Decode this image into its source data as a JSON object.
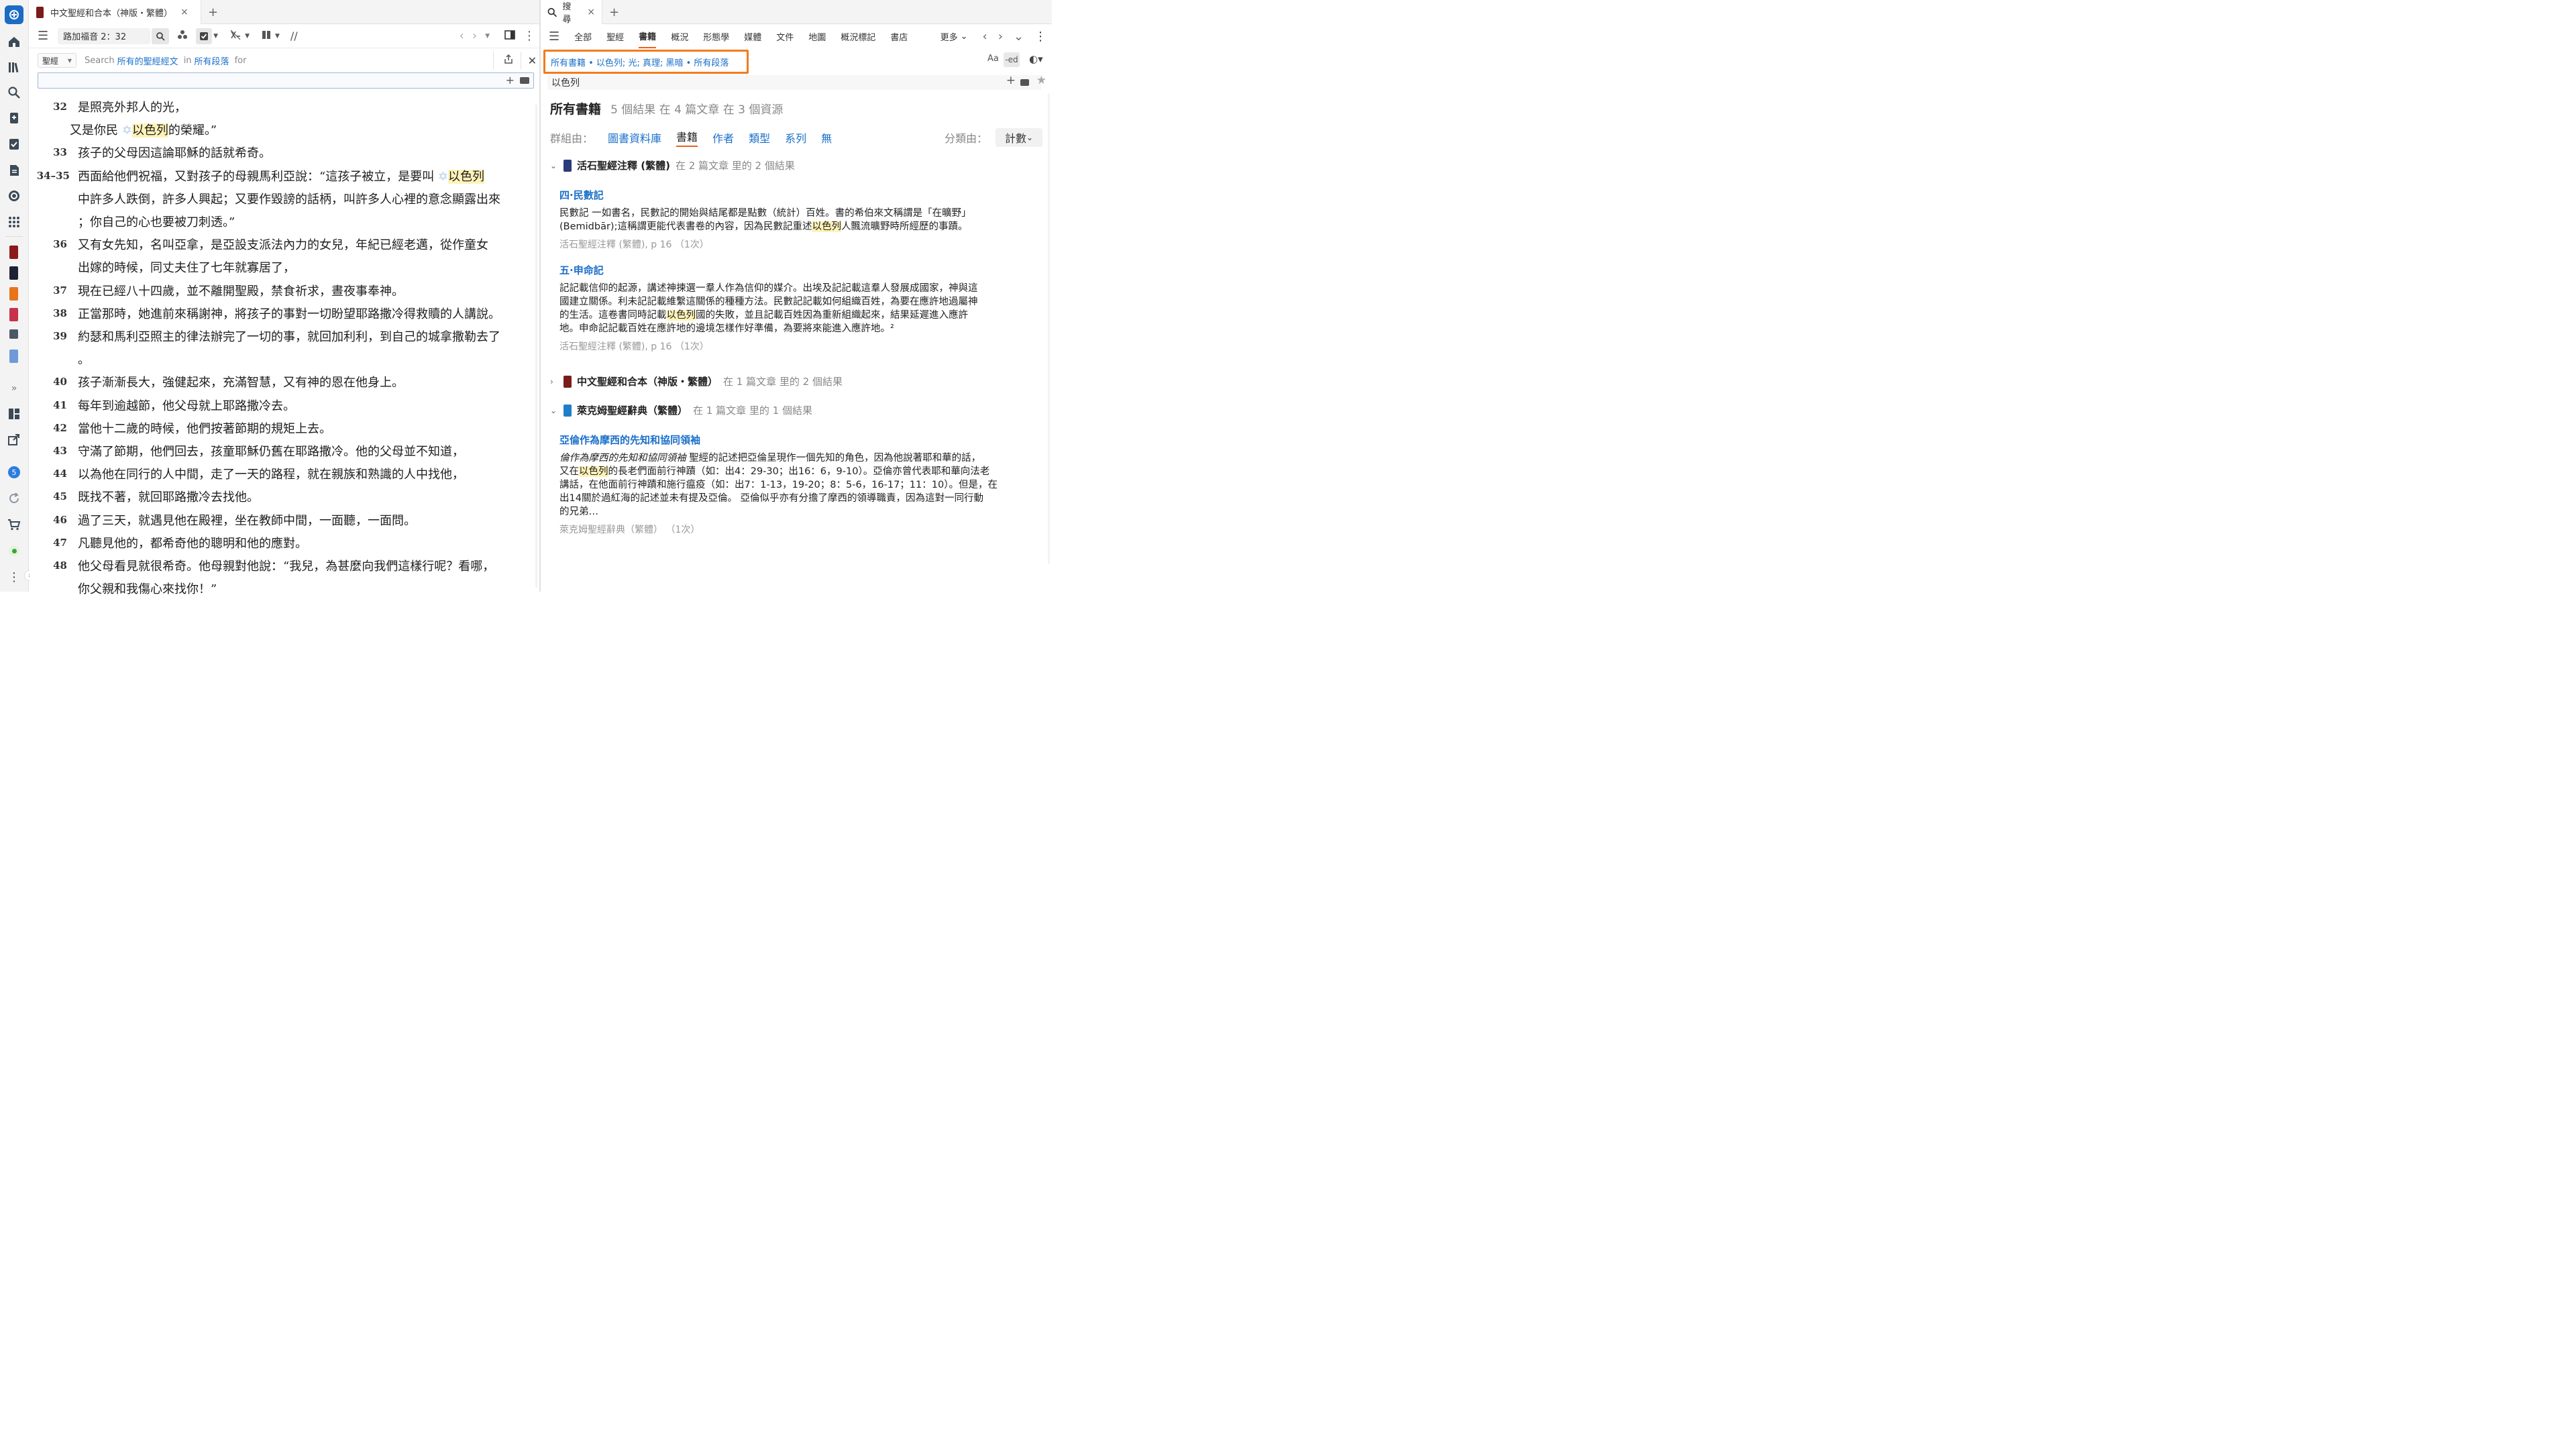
{
  "rail": {
    "icons": [
      "logos-icon",
      "home-icon",
      "library-icon",
      "search-icon",
      "notes-icon",
      "checklist-icon",
      "document-icon",
      "shield-icon",
      "apps-icon"
    ],
    "expand": "»",
    "badge": "5"
  },
  "left": {
    "tab_title": "中文聖經和合本（神版・繁體）",
    "tab_close": "×",
    "new_tab": "+",
    "reference": "路加福音 2：32",
    "search_scope": "聖經",
    "search_line": {
      "prefix": "Search",
      "scope": "所有的聖經經文",
      "in": "in",
      "where": "所有段落",
      "for": "for"
    },
    "verses": [
      {
        "num": "32",
        "parts": [
          {
            "t": "是照亮外邦人的光，"
          }
        ]
      },
      {
        "num": "",
        "indent": true,
        "parts": [
          {
            "t": "又是你民 "
          },
          {
            "t": "✡",
            "star": true
          },
          {
            "t": "以色列",
            "hl": true
          },
          {
            "t": "的榮耀。”"
          }
        ]
      },
      {
        "num": "33",
        "parts": [
          {
            "t": "孩子的父母因這論耶穌的話就希奇。"
          }
        ]
      },
      {
        "num": "34–35",
        "parts": [
          {
            "t": "西面給他們祝福，又對孩子的母親馬利亞說：“這孩子被立，是要叫 "
          },
          {
            "t": "✡",
            "star": true
          },
          {
            "t": "以色列",
            "hl": true
          }
        ]
      },
      {
        "num": "",
        "parts": [
          {
            "t": "中許多人跌倒，許多人興起；又要作毀謗的話柄，叫許多人心裡的意念顯露出來"
          }
        ]
      },
      {
        "num": "",
        "parts": [
          {
            "t": "；你自己的心也要被刀刺透。”"
          }
        ]
      },
      {
        "num": "36",
        "parts": [
          {
            "t": "又有女先知，名叫亞拿，是亞設支派法內力的女兒，年紀已經老邁，從作童女"
          }
        ]
      },
      {
        "num": "",
        "parts": [
          {
            "t": "出嫁的時候，同丈夫住了七年就寡居了，"
          }
        ]
      },
      {
        "num": "37",
        "parts": [
          {
            "t": "現在已經八十四歲，並不離開聖殿，禁食祈求，晝夜事奉神。"
          }
        ]
      },
      {
        "num": "38",
        "parts": [
          {
            "t": "正當那時，她進前來稱謝神，將孩子的事對一切盼望耶路撒冷得救贖的人講說。"
          }
        ]
      },
      {
        "num": "39",
        "parts": [
          {
            "t": "約瑟和馬利亞照主的律法辦完了一切的事，就回加利利，到自己的城拿撒勒去了"
          }
        ]
      },
      {
        "num": "",
        "parts": [
          {
            "t": "。"
          }
        ]
      },
      {
        "num": "40",
        "parts": [
          {
            "t": "孩子漸漸長大，強健起來，充滿智慧，又有神的恩在他身上。"
          }
        ]
      },
      {
        "num": "41",
        "parts": [
          {
            "t": "每年到逾越節，他父母就上耶路撒冷去。"
          }
        ]
      },
      {
        "num": "42",
        "parts": [
          {
            "t": "當他十二歲的時候，他們按著節期的規矩上去。"
          }
        ]
      },
      {
        "num": "43",
        "parts": [
          {
            "t": "守滿了節期，他們回去，孩童耶穌仍舊在耶路撒冷。他的父母並不知道，"
          }
        ]
      },
      {
        "num": "44",
        "parts": [
          {
            "t": "以為他在同行的人中間，走了一天的路程，就在親族和熟識的人中找他，"
          }
        ]
      },
      {
        "num": "45",
        "parts": [
          {
            "t": "既找不著，就回耶路撒冷去找他。"
          }
        ]
      },
      {
        "num": "46",
        "parts": [
          {
            "t": "過了三天，就遇見他在殿裡，坐在教師中間，一面聽，一面問。"
          }
        ]
      },
      {
        "num": "47",
        "parts": [
          {
            "t": "凡聽見他的，都希奇他的聰明和他的應對。"
          }
        ]
      },
      {
        "num": "48",
        "parts": [
          {
            "t": "他父母看見就很希奇。他母親對他說：“我兒，為甚麼向我們這樣行呢？看哪，"
          }
        ]
      },
      {
        "num": "",
        "parts": [
          {
            "t": "你父親和我傷心來找你！”"
          }
        ]
      }
    ]
  },
  "right": {
    "tab_title": "搜尋",
    "tab_close": "×",
    "new_tab": "+",
    "nav": [
      "全部",
      "聖經",
      "書籍",
      "概況",
      "形態學",
      "媒體",
      "文件",
      "地圖",
      "概況標記",
      "書店"
    ],
    "nav_active": "書籍",
    "more": "更多",
    "scope_chip": "所有書籍 • 以色列; 光; 真理; 黑暗 • 所有段落",
    "query": "以色列",
    "summary_title": "所有書籍",
    "summary_stats": "5 個結果 在 4 篇文章 在 3 個資源",
    "group_label": "群組由：",
    "group_options": [
      "圖書資料庫",
      "書籍",
      "作者",
      "類型",
      "系列",
      "無"
    ],
    "group_active": "書籍",
    "sort_label": "分類由：",
    "sort_value": "計數",
    "results": [
      {
        "book": "活石聖經注釋 (繁體)",
        "count": "在 2 篇文章 里的 2 個結果",
        "color": "#2a3a7a",
        "expanded": true,
        "articles": [
          {
            "title": "四·民數記",
            "lines": [
              [
                {
                  "t": "民數記 一如書名，民數記的開始與結尾都是點數（統計）百姓。書的希伯來文稱謂是「在曠野」"
                }
              ],
              [
                {
                  "t": "(Bemidbār);這稱謂更能代表書卷的內容，因為民數記重述"
                },
                {
                  "t": "以色列",
                  "hl": true
                },
                {
                  "t": "人飄流曠野時所經歷的事蹟。"
                }
              ]
            ],
            "source": "活石聖經注釋 (繁體), p 16 （1次）"
          },
          {
            "title": "五·申命記",
            "lines": [
              [
                {
                  "t": "記記載信仰的起源，講述神揀選一羣人作為信仰的媒介。出埃及記記載這羣人發展成國家，神與這"
                }
              ],
              [
                {
                  "t": "國建立關係。利未記記載維繫這關係的種種方法。民數記記載如何組織百姓，為要在應許地過屬神"
                }
              ],
              [
                {
                  "t": "的生活。這卷書同時記載"
                },
                {
                  "t": "以色列",
                  "hl": true
                },
                {
                  "t": "國的失敗，並且記載百姓因為重新組織起來，結果延遲進入應許"
                }
              ],
              [
                {
                  "t": "地。申命記記載百姓在應許地的邊境怎樣作好準備，為要將來能進入應許地。²"
                }
              ]
            ],
            "source": "活石聖經注釋 (繁體), p 16 （1次）"
          }
        ]
      },
      {
        "book": "中文聖經和合本（神版・繁體）",
        "count": "在 1 篇文章 里的 2 個結果",
        "color": "#7a1c1c",
        "expanded": false,
        "articles": []
      },
      {
        "book": "萊克姆聖經辭典（繁體）",
        "count": "在 1 篇文章 里的 1 個結果",
        "color": "#1e7fc8",
        "expanded": true,
        "articles": [
          {
            "title": "亞倫作為摩西的先知和協同領袖",
            "lines": [
              [
                {
                  "t": "倫作為摩西的先知和協同領袖",
                  "i": true
                },
                {
                  "t": " 聖經的記述把亞倫呈現作一個先知的角色，因為他說著耶和華的話，"
                }
              ],
              [
                {
                  "t": "又在"
                },
                {
                  "t": "以色列",
                  "hl": true
                },
                {
                  "t": "的長老們面前行神蹟（如：出4：29-30；出16：6，9-10）。亞倫亦曾代表耶和華向法老"
                }
              ],
              [
                {
                  "t": "講話，在他面前行神蹟和施行瘟疫（如：出7：1-13，19-20；8：5-6，16-17；11：10）。但是，在"
                }
              ],
              [
                {
                  "t": "出14關於過紅海的記述並未有提及亞倫。 亞倫似乎亦有分擔了摩西的領導職責，因為這對一同行動"
                }
              ],
              [
                {
                  "t": "的兄弟…"
                }
              ]
            ],
            "source": "萊克姆聖經辭典（繁體） （1次）"
          }
        ]
      }
    ]
  }
}
